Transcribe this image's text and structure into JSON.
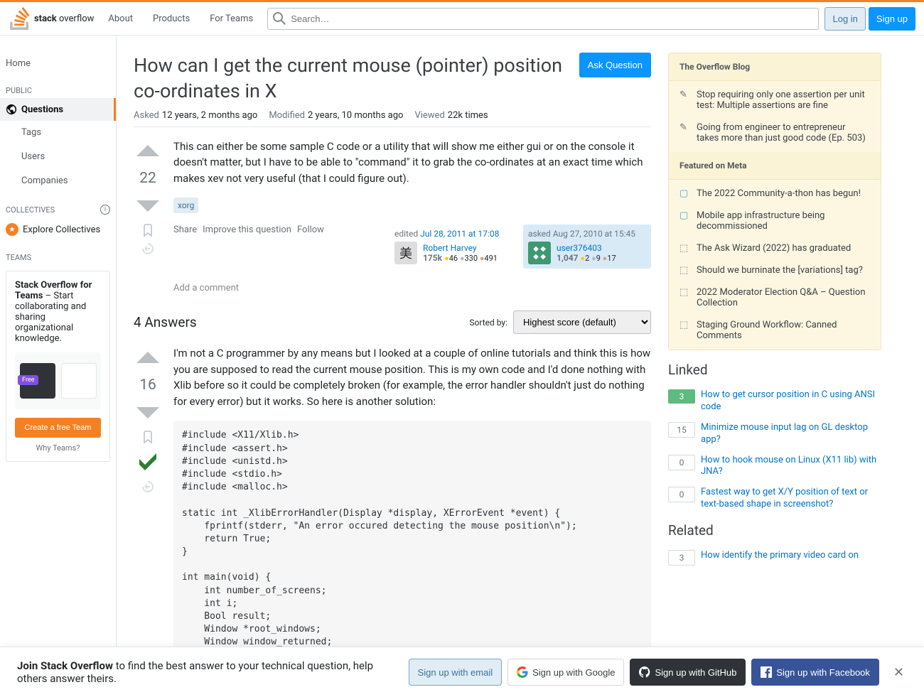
{
  "topbar": {
    "logo_text": "stack overflow",
    "nav": [
      "About",
      "Products",
      "For Teams"
    ],
    "search_placeholder": "Search…",
    "login": "Log in",
    "signup": "Sign up"
  },
  "sidebar": {
    "home": "Home",
    "public_header": "PUBLIC",
    "questions": "Questions",
    "tags": "Tags",
    "users": "Users",
    "companies": "Companies",
    "collectives_header": "COLLECTIVES",
    "explore_collectives": "Explore Collectives",
    "teams_header": "TEAMS",
    "teams_title": "Stack Overflow for Teams",
    "teams_desc": " – Start collaborating and sharing organizational knowledge.",
    "teams_free": "Free",
    "teams_create": "Create a free Team",
    "teams_why": "Why Teams?"
  },
  "question": {
    "title": "How can I get the current mouse (pointer) position co-ordinates in X",
    "ask_button": "Ask Question",
    "asked_label": "Asked",
    "asked_value": "12 years, 2 months ago",
    "modified_label": "Modified",
    "modified_value": "2 years, 10 months ago",
    "viewed_label": "Viewed",
    "viewed_value": "22k times",
    "vote_count": "22",
    "body": "This can either be some sample C code or a utility that will show me either gui or on the console it doesn't matter, but I have to be able to \"command\" it to grab the co-ordinates at an exact time which makes xev not very useful (that I could figure out).",
    "tags": [
      "xorg"
    ],
    "share": "Share",
    "improve": "Improve this question",
    "follow": "Follow",
    "editor": {
      "action": "edited ",
      "time": "Jul 28, 2011 at 17:08",
      "name": "Robert Harvey",
      "rep": "175k",
      "gold": "46",
      "silver": "330",
      "bronze": "491"
    },
    "asker": {
      "action": "asked ",
      "time": "Aug 27, 2010 at 15:45",
      "name": "user376403",
      "rep": "1,047",
      "gold": "2",
      "silver": "9",
      "bronze": "17"
    },
    "add_comment": "Add a comment"
  },
  "answers": {
    "count_label": "4 Answers",
    "sorted_by": "Sorted by:",
    "sort_option": "Highest score (default)",
    "answer1": {
      "vote_count": "16",
      "body": "I'm not a C programmer by any means but I looked at a couple of online tutorials and think this is how you are supposed to read the current mouse position. This is my own code and I'd done nothing with Xlib before so it could be completely broken (for example, the error handler shouldn't just do nothing for every error) but it works. So here is another solution:",
      "code": "#include <X11/Xlib.h>\n#include <assert.h>\n#include <unistd.h>\n#include <stdio.h>\n#include <malloc.h>\n\nstatic int _XlibErrorHandler(Display *display, XErrorEvent *event) {\n    fprintf(stderr, \"An error occured detecting the mouse position\\n\");\n    return True;\n}\n\nint main(void) {\n    int number_of_screens;\n    int i;\n    Bool result;\n    Window *root_windows;\n    Window window_returned;\n    int root_x, root_y;"
    }
  },
  "widget": {
    "blog_header": "The Overflow Blog",
    "blog_items": [
      "Stop requiring only one assertion per unit test: Multiple assertions are fine",
      "Going from engineer to entrepreneur takes more than just good code (Ep. 503)"
    ],
    "meta_header": "Featured on Meta",
    "meta_items": [
      "The 2022 Community-a-thon has begun!",
      "Mobile app infrastructure being decommissioned",
      "The Ask Wizard (2022) has graduated",
      "Should we burninate the [variations] tag?",
      "2022 Moderator Election Q&A – Question Collection",
      "Staging Ground Workflow: Canned Comments"
    ]
  },
  "linked": {
    "header": "Linked",
    "items": [
      {
        "score": "3",
        "answered": true,
        "title": "How to get cursor position in C using ANSI code"
      },
      {
        "score": "15",
        "answered": false,
        "title": "Minimize mouse input lag on GL desktop app?"
      },
      {
        "score": "0",
        "answered": false,
        "title": "How to hook mouse on Linux (X11 lib) with JNA?"
      },
      {
        "score": "0",
        "answered": false,
        "title": "Fastest way to get X/Y position of text or text-based shape in screenshot?"
      }
    ]
  },
  "related": {
    "header": "Related",
    "items": [
      {
        "score": "3",
        "answered": false,
        "title": "How identify the primary video card on"
      }
    ]
  },
  "banner": {
    "bold": "Join Stack Overflow",
    "text": " to find the best answer to your technical question, help others answer theirs.",
    "email": "Sign up with email",
    "google": "Sign up with Google",
    "github": "Sign up with GitHub",
    "facebook": "Sign up with Facebook"
  }
}
